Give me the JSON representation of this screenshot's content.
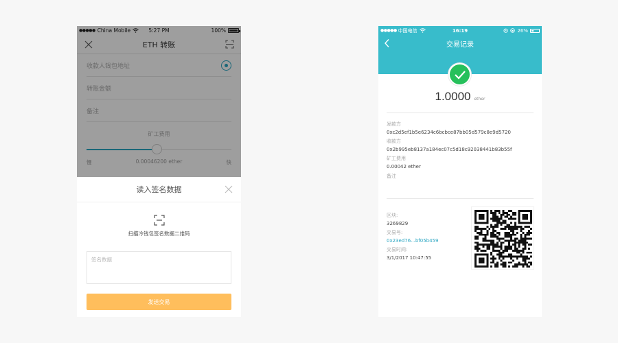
{
  "left_phone": {
    "status": {
      "carrier": "China Mobile",
      "time": "5:27 PM",
      "battery": "100%"
    },
    "nav": {
      "title": "ETH 转账"
    },
    "form": {
      "address_placeholder": "收款人钱包地址",
      "amount_placeholder": "转账金额",
      "note_placeholder": "备注",
      "fee_title": "矿工费用",
      "fee_slow": "慢",
      "fee_value": "0.00046200 ether",
      "fee_fast": "快"
    },
    "sheet": {
      "title": "读入签名数据",
      "scan_caption": "扫描冷钱包签名数据二维码",
      "textarea_placeholder": "签名数据",
      "send_button": "发送交易"
    }
  },
  "right_phone": {
    "status": {
      "carrier": "中国电信",
      "time": "16:19",
      "battery": "26%"
    },
    "nav": {
      "title": "交易记录"
    },
    "amount": {
      "value": "1.0000",
      "unit": "ether"
    },
    "details": {
      "from_label": "发款方",
      "from_value": "0xc2d5ef1b5e6234c6bcbce87bb05d579c8e9d5720",
      "to_label": "收款方",
      "to_value": "0x2b995eb8137a184ec07c5d18c92038441b83b55f",
      "fee_label": "矿工费用",
      "fee_value": "0.00042 ether",
      "note_label": "备注"
    },
    "block": {
      "block_label": "区块:",
      "block_value": "3269829",
      "tx_label": "交易号:",
      "tx_value": "0x23ed76...bf05b459",
      "time_label": "交易时间:",
      "time_value": "3/1/2017 10:47:55"
    }
  },
  "colors": {
    "teal": "#38bccb",
    "success_green": "#26c05b",
    "send_orange": "#ffbe5c",
    "link_blue": "#2ba6c2"
  }
}
